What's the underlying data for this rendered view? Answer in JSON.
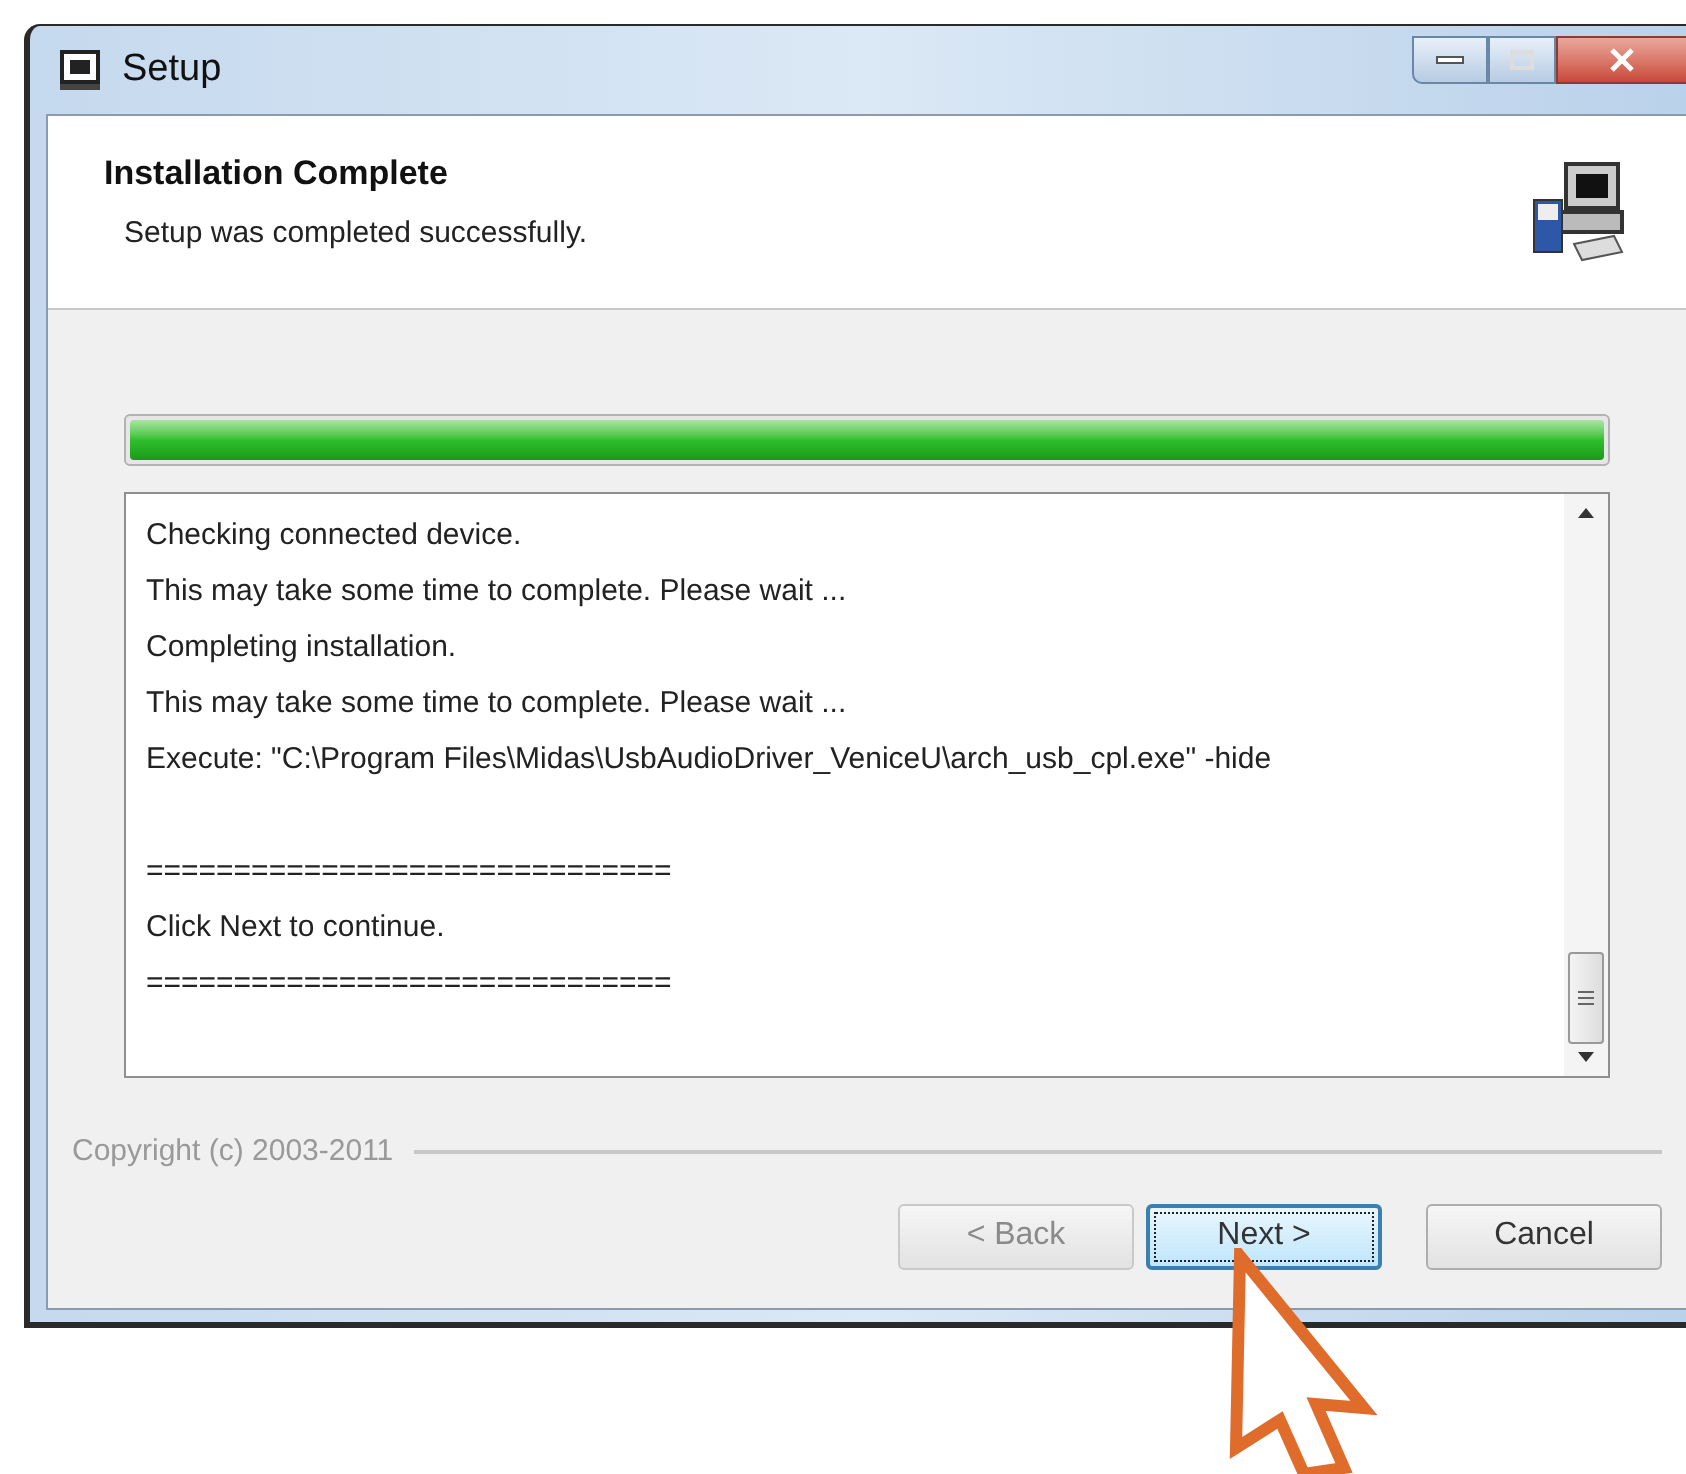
{
  "window": {
    "title": "Setup"
  },
  "header": {
    "title": "Installation Complete",
    "subtitle": "Setup was completed successfully."
  },
  "progress": {
    "level": 1
  },
  "log": {
    "lines": [
      {
        "kind": "text",
        "text": "Checking connected device."
      },
      {
        "kind": "text",
        "text": "This may take some time to complete. Please wait ..."
      },
      {
        "kind": "text",
        "text": "Completing installation."
      },
      {
        "kind": "text",
        "text": "This may take some time to complete. Please wait ..."
      },
      {
        "kind": "text",
        "text": "Execute: \"C:\\Program Files\\Midas\\UsbAudioDriver_VeniceU\\arch_usb_cpl.exe\" -hide"
      },
      {
        "kind": "blank"
      },
      {
        "kind": "text",
        "text": "=============================="
      },
      {
        "kind": "text",
        "text": "Click Next to continue."
      },
      {
        "kind": "text",
        "text": "=============================="
      }
    ]
  },
  "footer": {
    "copyright": "Copyright (c) 2003-2011"
  },
  "buttons": [
    {
      "label": "< Back",
      "disabled": true,
      "focused": false
    },
    {
      "label": "Next >",
      "disabled": false,
      "focused": true
    },
    {
      "label": "Cancel",
      "disabled": false,
      "focused": false
    }
  ]
}
